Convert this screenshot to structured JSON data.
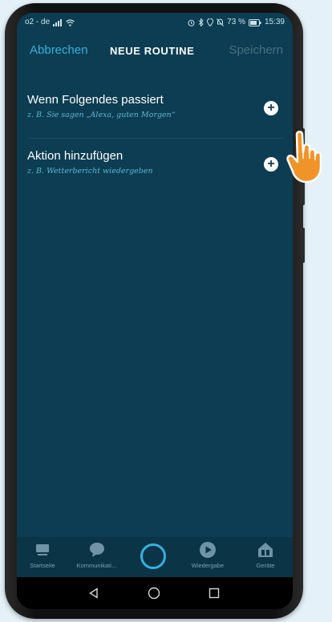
{
  "status_bar": {
    "carrier": "o2 - de",
    "battery_pct": "73 %",
    "time": "15:39"
  },
  "topbar": {
    "cancel_label": "Abbrechen",
    "title": "NEUE ROUTINE",
    "save_label": "Speichern"
  },
  "rows": [
    {
      "label": "Wenn Folgendes passiert",
      "hint": "z. B. Sie sagen „Alexa, guten Morgen“"
    },
    {
      "label": "Aktion hinzufügen",
      "hint": "z. B. Wetterbericht wiedergeben"
    }
  ],
  "bottom_nav": {
    "items": [
      {
        "label": "Startseite",
        "icon": "home-icon"
      },
      {
        "label": "Kommunikati…",
        "icon": "chat-bubble-icon"
      },
      {
        "label": "",
        "icon": "alexa-ring-icon"
      },
      {
        "label": "Wiedergabe",
        "icon": "play-icon"
      },
      {
        "label": "Geräte",
        "icon": "devices-house-icon"
      }
    ]
  },
  "colors": {
    "screen_bg": "#0c3d52",
    "accent": "#35b1de",
    "hint_text": "#5fb6d8",
    "hand": "#f0942a"
  }
}
